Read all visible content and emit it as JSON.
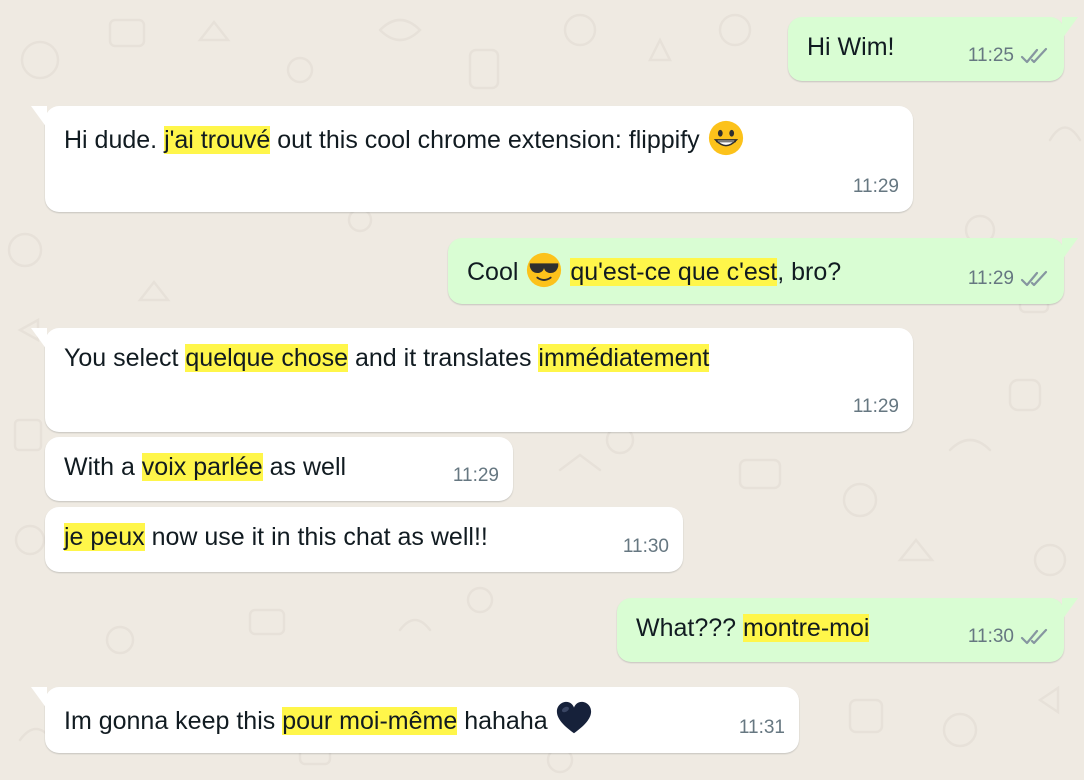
{
  "colors": {
    "background": "#efeae2",
    "incoming_bubble": "#ffffff",
    "outgoing_bubble": "#d9fdd3",
    "highlight": "#fff64a",
    "timestamp": "#667781",
    "read_ticks": "#8696a0"
  },
  "messages": [
    {
      "direction": "outgoing",
      "segments": [
        "Hi Wim!"
      ],
      "time": "11:25",
      "status": "double-check-icon"
    },
    {
      "direction": "incoming",
      "segments": [
        "Hi dude. ",
        "j'ai trouvé",
        " out this cool chrome extension: flippify "
      ],
      "emoji": "grinning-face-emoji",
      "time": "11:29"
    },
    {
      "direction": "outgoing",
      "segments": [
        "Cool ",
        " ",
        "qu'est-ce que c'est",
        ", bro?"
      ],
      "emoji": "smiling-face-with-sunglasses-emoji",
      "time": "11:29",
      "status": "double-check-icon"
    },
    {
      "direction": "incoming",
      "segments": [
        "You select ",
        "quelque chose",
        " and it translates ",
        "immédiatement"
      ],
      "time": "11:29"
    },
    {
      "direction": "incoming",
      "segments": [
        "With a ",
        "voix parlée",
        " as well"
      ],
      "time": "11:29"
    },
    {
      "direction": "incoming",
      "segments": [
        "je peux",
        " now use it in this chat as well!!"
      ],
      "time": "11:30"
    },
    {
      "direction": "outgoing",
      "segments": [
        "What??? ",
        "montre-moi"
      ],
      "time": "11:30",
      "status": "double-check-icon"
    },
    {
      "direction": "incoming",
      "segments": [
        "Im gonna keep this ",
        "pour moi-même",
        " hahaha "
      ],
      "emoji": "black-heart-emoji",
      "time": "11:31"
    }
  ]
}
